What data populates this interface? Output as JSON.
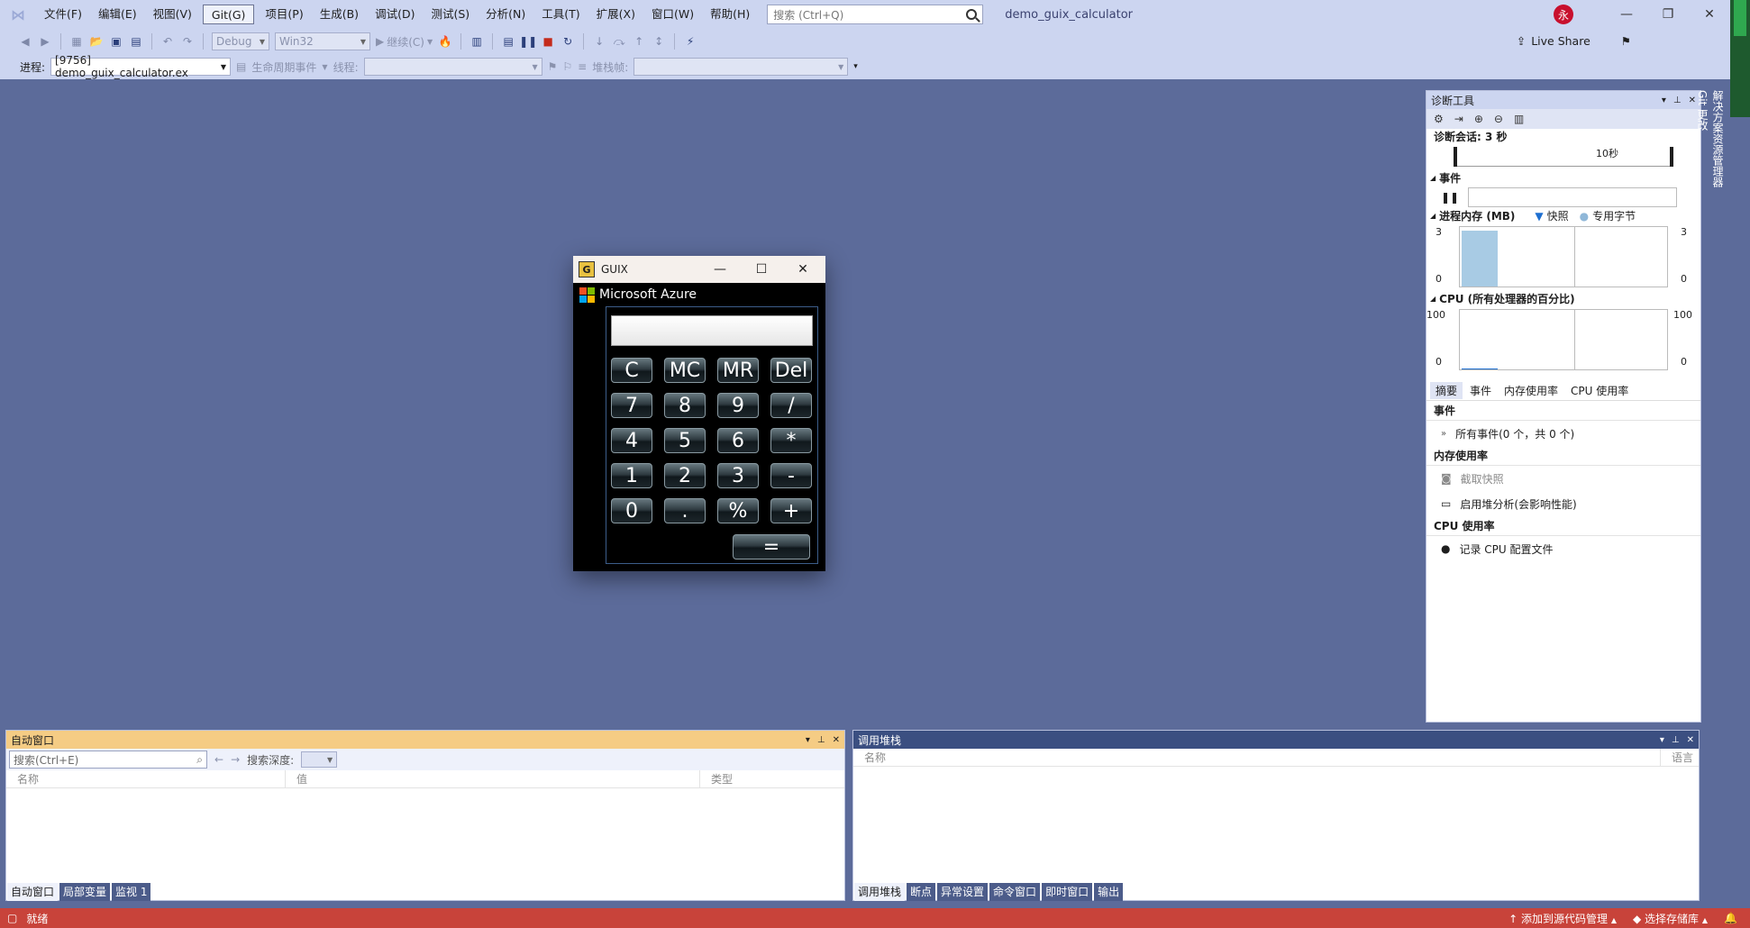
{
  "window": {
    "title": "demo_guix_calculator",
    "search_placeholder": "搜索 (Ctrl+Q)",
    "avatar": "永"
  },
  "menu": [
    "文件(F)",
    "编辑(E)",
    "视图(V)",
    "Git(G)",
    "项目(P)",
    "生成(B)",
    "调试(D)",
    "测试(S)",
    "分析(N)",
    "工具(T)",
    "扩展(X)",
    "窗口(W)",
    "帮助(H)"
  ],
  "toolbar": {
    "config": "Debug",
    "platform": "Win32",
    "continue": "继续(C)",
    "live_share": "Live Share"
  },
  "toolbar2": {
    "process_label": "进程:",
    "process_value": "[9756] demo_guix_calculator.ex",
    "lifecycle": "生命周期事件",
    "thread_label": "线程:",
    "stack_label": "堆栈帧:"
  },
  "guix": {
    "title": "GUIX",
    "brand": "Microsoft Azure",
    "buttons": [
      "C",
      "MC",
      "MR",
      "Del",
      "7",
      "8",
      "9",
      "/",
      "4",
      "5",
      "6",
      "*",
      "1",
      "2",
      "3",
      "-",
      "0",
      ".",
      "%",
      "+",
      "="
    ]
  },
  "diag": {
    "title": "诊断工具",
    "session": "诊断会话: 3 秒",
    "ruler_label": "10秒",
    "events_title": "事件",
    "memory_title": "进程内存 (MB)",
    "legend_snapshot": "快照",
    "legend_private": "专用字节",
    "memory_max": "3",
    "memory_min": "0",
    "cpu_title": "CPU (所有处理器的百分比)",
    "cpu_max": "100",
    "cpu_min": "0",
    "tabs": [
      "摘要",
      "事件",
      "内存使用率",
      "CPU 使用率"
    ],
    "grp_events": "事件",
    "all_events": "所有事件(0 个，共 0 个)",
    "grp_memory": "内存使用率",
    "take_snapshot": "截取快照",
    "heap_profile": "启用堆分析(会影响性能)",
    "grp_cpu": "CPU 使用率",
    "record_cpu": "记录 CPU 配置文件"
  },
  "vtabs": [
    "解决方案资源管理器",
    "Git 更改"
  ],
  "autos": {
    "title": "自动窗口",
    "search_placeholder": "搜索(Ctrl+E)",
    "depth_label": "搜索深度:",
    "columns": [
      "名称",
      "值",
      "类型"
    ],
    "tabs": [
      "自动窗口",
      "局部变量",
      "监视 1"
    ]
  },
  "callstack": {
    "title": "调用堆栈",
    "columns": [
      "名称",
      "语言"
    ],
    "tabs": [
      "调用堆栈",
      "断点",
      "异常设置",
      "命令窗口",
      "即时窗口",
      "输出"
    ]
  },
  "status": {
    "ready": "就绪",
    "add_source": "添加到源代码管理",
    "select_repo": "选择存储库"
  }
}
